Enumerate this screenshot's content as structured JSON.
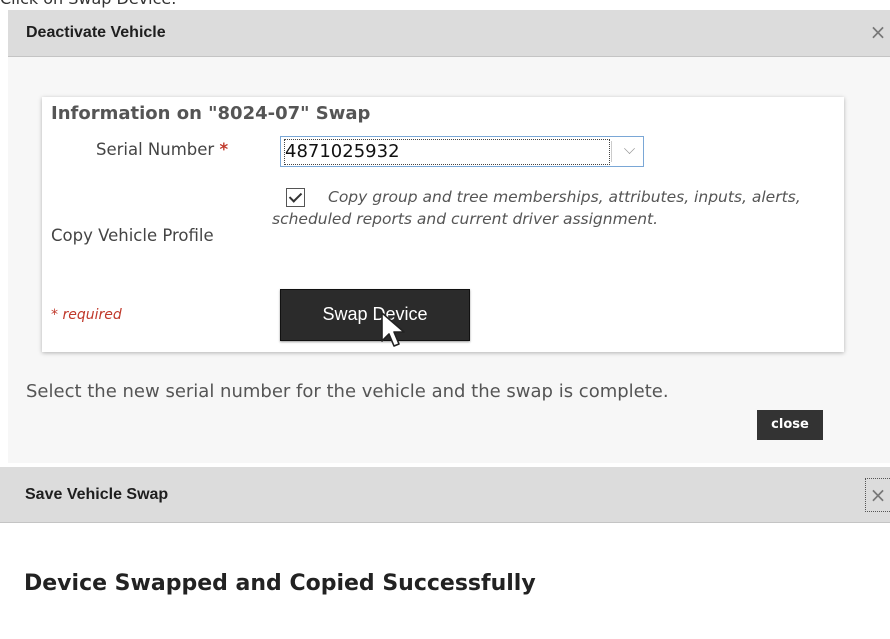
{
  "caption": "Click on Swap Device.",
  "deactivate_dialog": {
    "title": "Deactivate Vehicle",
    "close_glyph": "×",
    "panel": {
      "heading": "Information on \"8024-07\" Swap",
      "serial_label": "Serial Number",
      "required_star": "*",
      "serial_value": "4871025932",
      "copy_label": "Copy Vehicle Profile",
      "copy_checked": true,
      "copy_text": "Copy group and tree memberships, attributes, inputs, alerts, scheduled reports and current driver assignment.",
      "required_note": "* required",
      "swap_button": "Swap Device"
    },
    "instruction": "Select the new serial number for the vehicle and the swap is complete.",
    "close_button": "close"
  },
  "save_dialog": {
    "title": "Save Vehicle Swap",
    "close_glyph": "×",
    "message": "Device Swapped and Copied Successfully"
  }
}
